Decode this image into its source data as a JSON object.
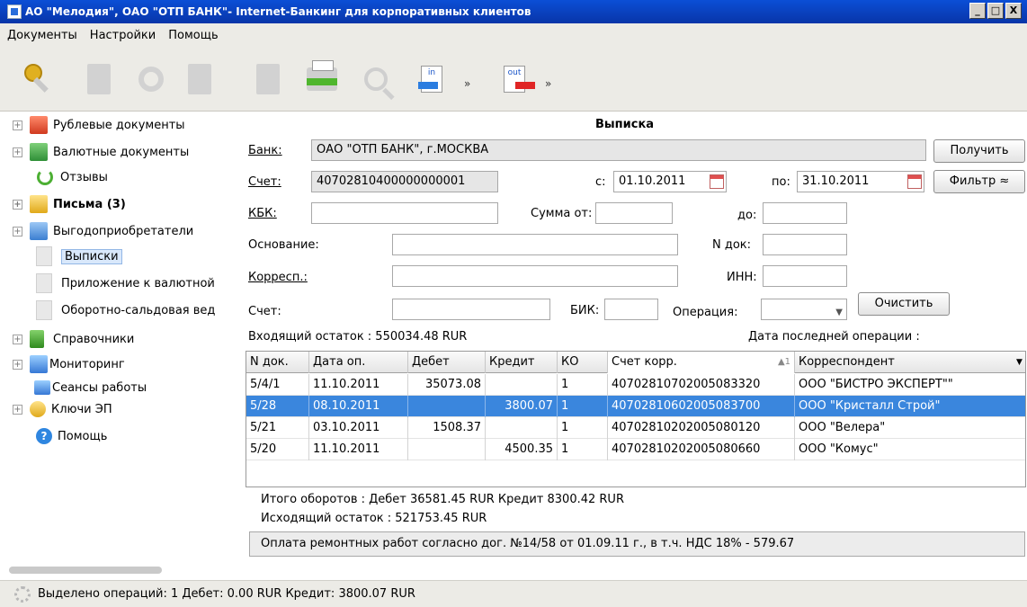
{
  "window": {
    "title": "АО \"Мелодия\", ОАО \"ОТП БАНК\"- Internet-Банкинг для корпоративных клиентов",
    "minimize": "_",
    "maximize": "□",
    "close": "X"
  },
  "menu": [
    "Документы",
    "Настройки",
    "Помощь"
  ],
  "toolbar": {
    "icons": [
      "keys-icon",
      "new-document-icon",
      "refresh-icon",
      "delete-icon",
      "edit-icon",
      "print-icon",
      "search-icon",
      "import-in-icon",
      "export-out-icon"
    ],
    "in_label": "in",
    "out_label": "out",
    "more": "»"
  },
  "sidebar": {
    "items": [
      {
        "label": "Рублевые документы",
        "icon": "ruble-folder-icon"
      },
      {
        "label": "Валютные документы",
        "icon": "currency-folder-icon"
      },
      {
        "label": "Отзывы",
        "icon": "refresh-icon"
      },
      {
        "label": "Письма (3)",
        "icon": "letters-folder-icon"
      },
      {
        "label": "Выгодоприобретатели",
        "icon": "folder-icon"
      },
      {
        "label": "Выписки",
        "icon": "document-icon"
      },
      {
        "label": "Приложение к валютной",
        "icon": "document-icon"
      },
      {
        "label": "Оборотно-сальдовая вед",
        "icon": "document-icon"
      },
      {
        "label": "Справочники",
        "icon": "book-icon"
      },
      {
        "label": "Мониторинг",
        "icon": "monitor-icon"
      },
      {
        "label": "Сеансы работы",
        "icon": "computer-icon"
      },
      {
        "label": "Ключи ЭП",
        "icon": "keys-icon"
      },
      {
        "label": "Помощь",
        "icon": "help-icon"
      }
    ],
    "expander": "+",
    "help_glyph": "?"
  },
  "statement": {
    "title": "Выписка",
    "bank_label": "Банк:",
    "bank_value": "ОАО \"ОТП БАНК\", г.МОСКВА",
    "account_label": "Счет:",
    "account_value": "40702810400000000001",
    "from_label": "с:",
    "from_value": "01.10.2011",
    "to_label": "по:",
    "to_value": "31.10.2011",
    "kbk_label": "КБК:",
    "sum_from_label": "Сумма от:",
    "sum_to_label": "до:",
    "basis_label": "Основание:",
    "doc_no_label": "N док:",
    "corr_label": "Корресп.:",
    "inn_label": "ИНН:",
    "acc2_label": "Счет:",
    "bik_label": "БИК:",
    "operation_label": "Операция:",
    "select_arrow": "▼",
    "buttons": {
      "get": "Получить",
      "filter": "Фильтр ≈",
      "clear": "Очистить"
    },
    "opening_balance": "Входящий остаток : 550034.48 RUR",
    "last_op_label": "Дата последней операции :"
  },
  "table": {
    "columns": [
      "N док.",
      "Дата оп.",
      "Дебет",
      "Кредит",
      "КО",
      "Счет корр.",
      "Корреспондент"
    ],
    "sort_indicator": "▲1",
    "dropdown": "▼",
    "rows": [
      [
        "5/4/1",
        "11.10.2011",
        "35073.08",
        "",
        "1",
        "40702810702005083320",
        "ООО \"БИСТРО ЭКСПЕРТ\"\""
      ],
      [
        "5/28",
        "08.10.2011",
        "",
        "3800.07",
        "1",
        "40702810602005083700",
        "ООО \"Кристалл Строй\""
      ],
      [
        "5/21",
        "03.10.2011",
        "1508.37",
        "",
        "1",
        "40702810202005080120",
        "ООО \"Велера\""
      ],
      [
        "5/20",
        "11.10.2011",
        "",
        "4500.35",
        "1",
        "40702810202005080660",
        "ООО \"Комус\""
      ]
    ]
  },
  "totals": {
    "turnover": "Итого оборотов : Дебет  36581.45 RUR  Кредит  8300.42 RUR",
    "closing": "Исходящий остаток : 521753.45 RUR"
  },
  "purpose": "Оплата ремонтных работ согласно дог. №14/58 от 01.09.11 г., в т.ч. НДС 18% - 579.67",
  "status": "Выделено операций: 1 Дебет: 0.00 RUR Кредит: 3800.07 RUR"
}
